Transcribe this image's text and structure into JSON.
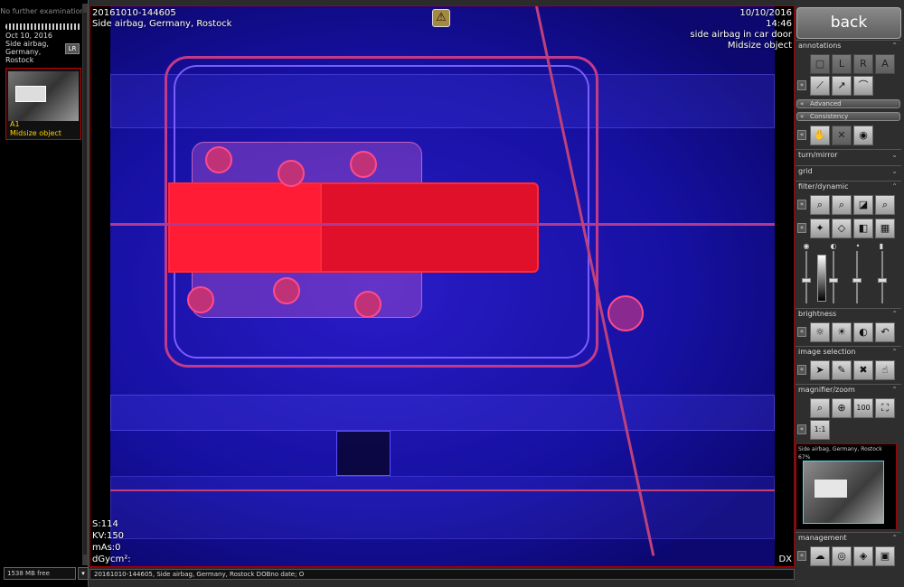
{
  "left_panel": {
    "no_further": "No further examinations",
    "thumb": {
      "date": "Oct 10, 2016",
      "line1": "Side airbag,",
      "line2": "Germany,",
      "line3": "Rostock",
      "lr": "LR"
    },
    "selected": {
      "label": "A1",
      "desc": "Midsize object"
    },
    "status": "1538 MB free",
    "status_btn": "▾"
  },
  "viewer": {
    "id": "20161010-144605",
    "place": "Side airbag, Germany, Rostock",
    "date": "10/10/2016",
    "time": "14:46",
    "obj1": "side airbag in car door",
    "obj2": "Midsize object",
    "warning": "⚠",
    "s": "S:114",
    "kv": "KV:150",
    "mas": "mAs:0",
    "dgy": "dGycm²:",
    "dx": "DX"
  },
  "bottom_bar": "20161010-144605, Side airbag, Germany, Rostock DOBno date; O",
  "right_panel": {
    "back": "back",
    "annotations": "annotations",
    "advanced": "Advanced",
    "consistency": "Consistency",
    "turn": "turn/mirror",
    "grid": "grid",
    "filter": "filter/dynamic",
    "brightness": "brightness",
    "image_selection": "image selection",
    "magnifier": "magnifier/zoom",
    "management": "management",
    "zoom_100": "100",
    "zoom_11": "1:1",
    "nav_caption": "Side airbag, Germany, Rostock",
    "nav_pct": "67%"
  }
}
